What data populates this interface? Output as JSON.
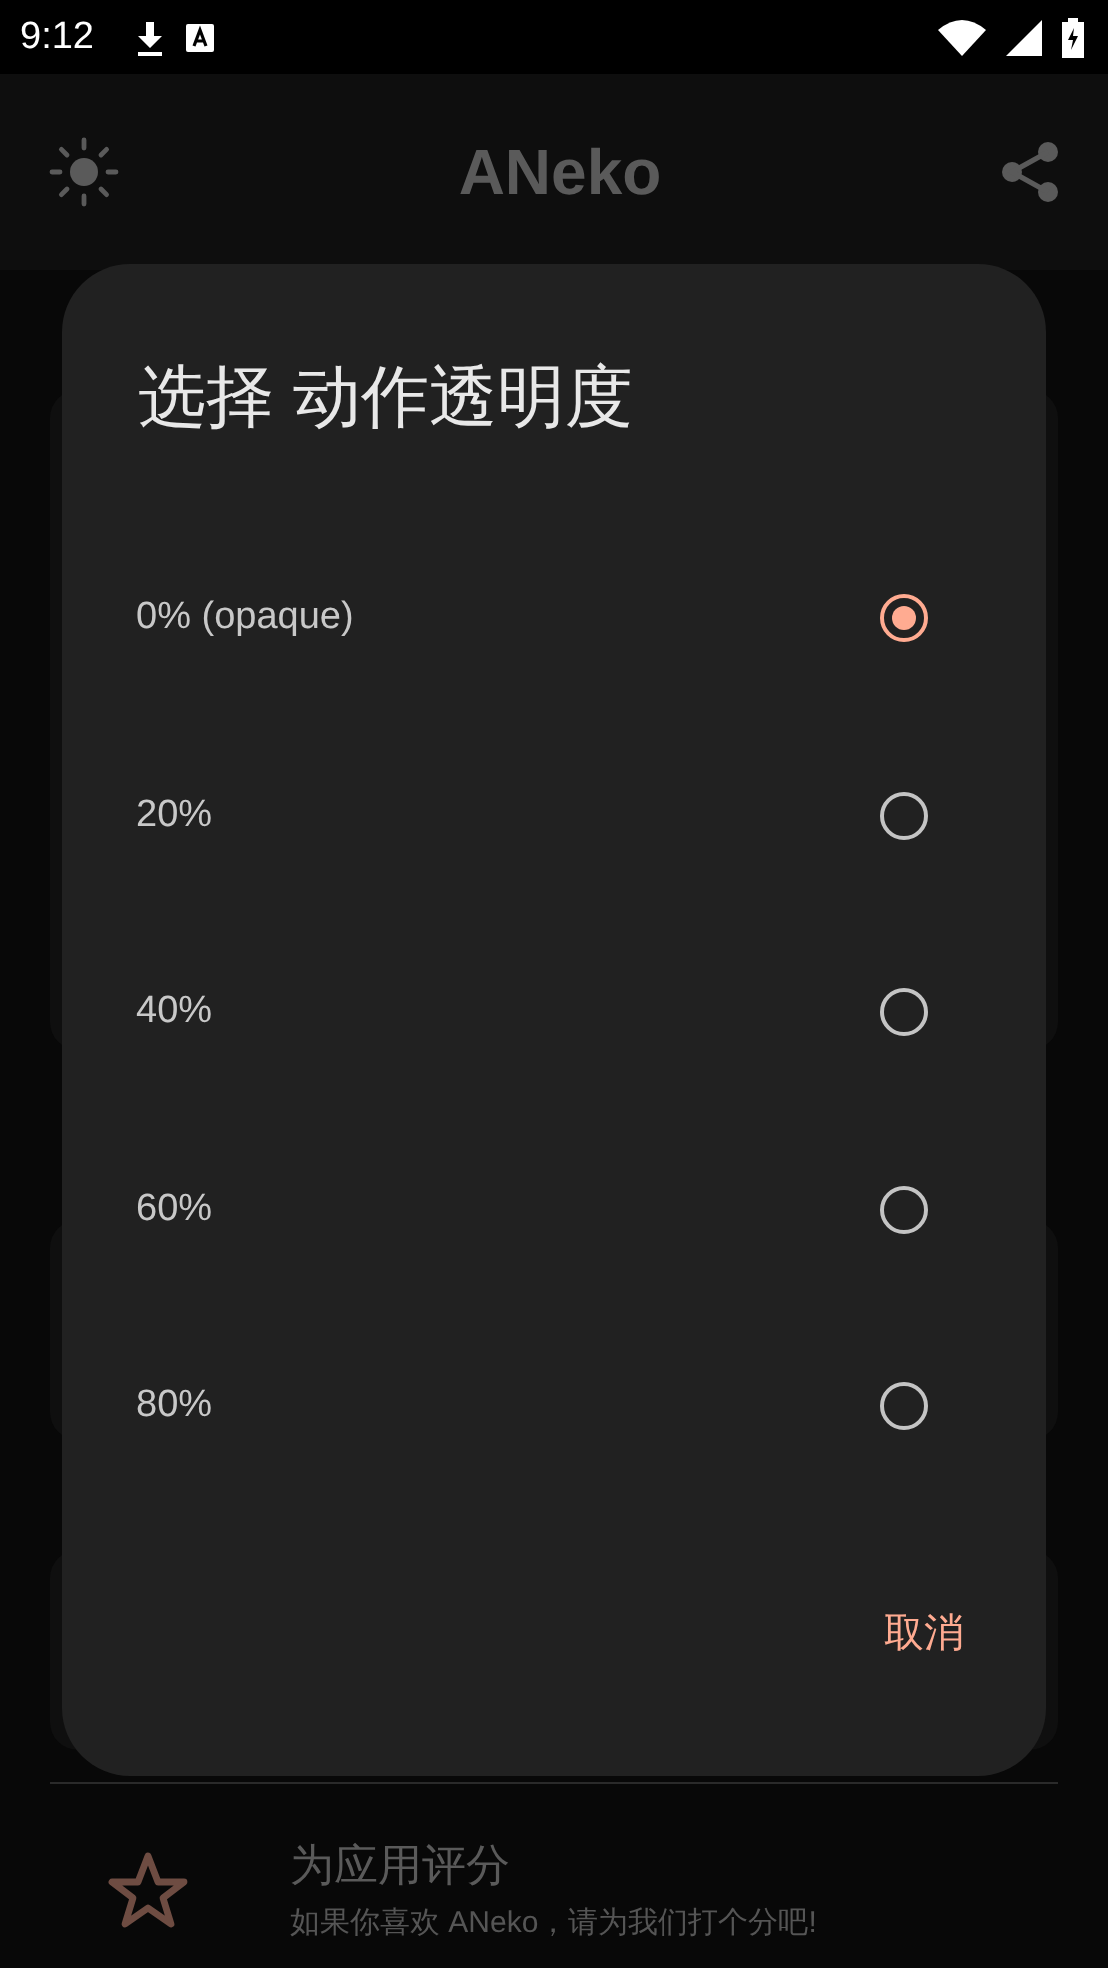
{
  "status_bar": {
    "time": "9:12"
  },
  "app_bar": {
    "title": "ANeko"
  },
  "background_item": {
    "title": "为应用评分",
    "subtitle": "如果你喜欢 ANeko，请为我们打个分吧!"
  },
  "dialog": {
    "title": "选择 动作透明度",
    "options": [
      {
        "label": "0% (opaque)",
        "selected": true
      },
      {
        "label": "20%",
        "selected": false
      },
      {
        "label": "40%",
        "selected": false
      },
      {
        "label": "60%",
        "selected": false
      },
      {
        "label": "80%",
        "selected": false
      }
    ],
    "buttons": [
      "取消"
    ]
  }
}
